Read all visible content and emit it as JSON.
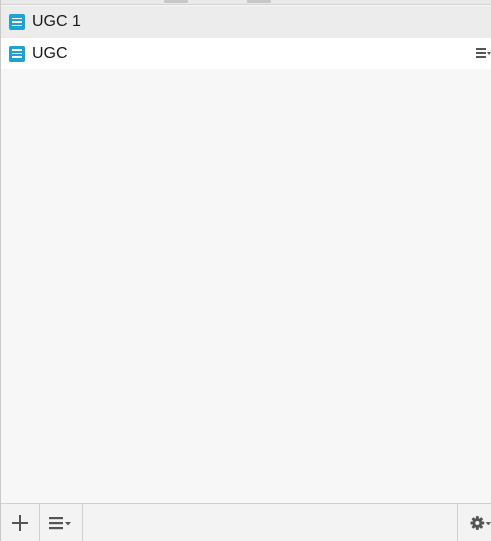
{
  "items": [
    {
      "label": "UGC 1",
      "icon": "document-list-icon",
      "selected": false
    },
    {
      "label": "UGC",
      "icon": "document-list-icon",
      "selected": true,
      "row_menu_icon": "menu-dropdown-icon"
    }
  ],
  "footer": {
    "add_icon": "plus-icon",
    "list_menu_icon": "menu-dropdown-icon",
    "settings_icon": "gear-dropdown-icon"
  },
  "colors": {
    "background": "#f7f7f7",
    "row_grey": "#ececec",
    "row_white": "#ffffff",
    "icon_blue": "#1ea0d8",
    "icon_grey": "#555555"
  }
}
